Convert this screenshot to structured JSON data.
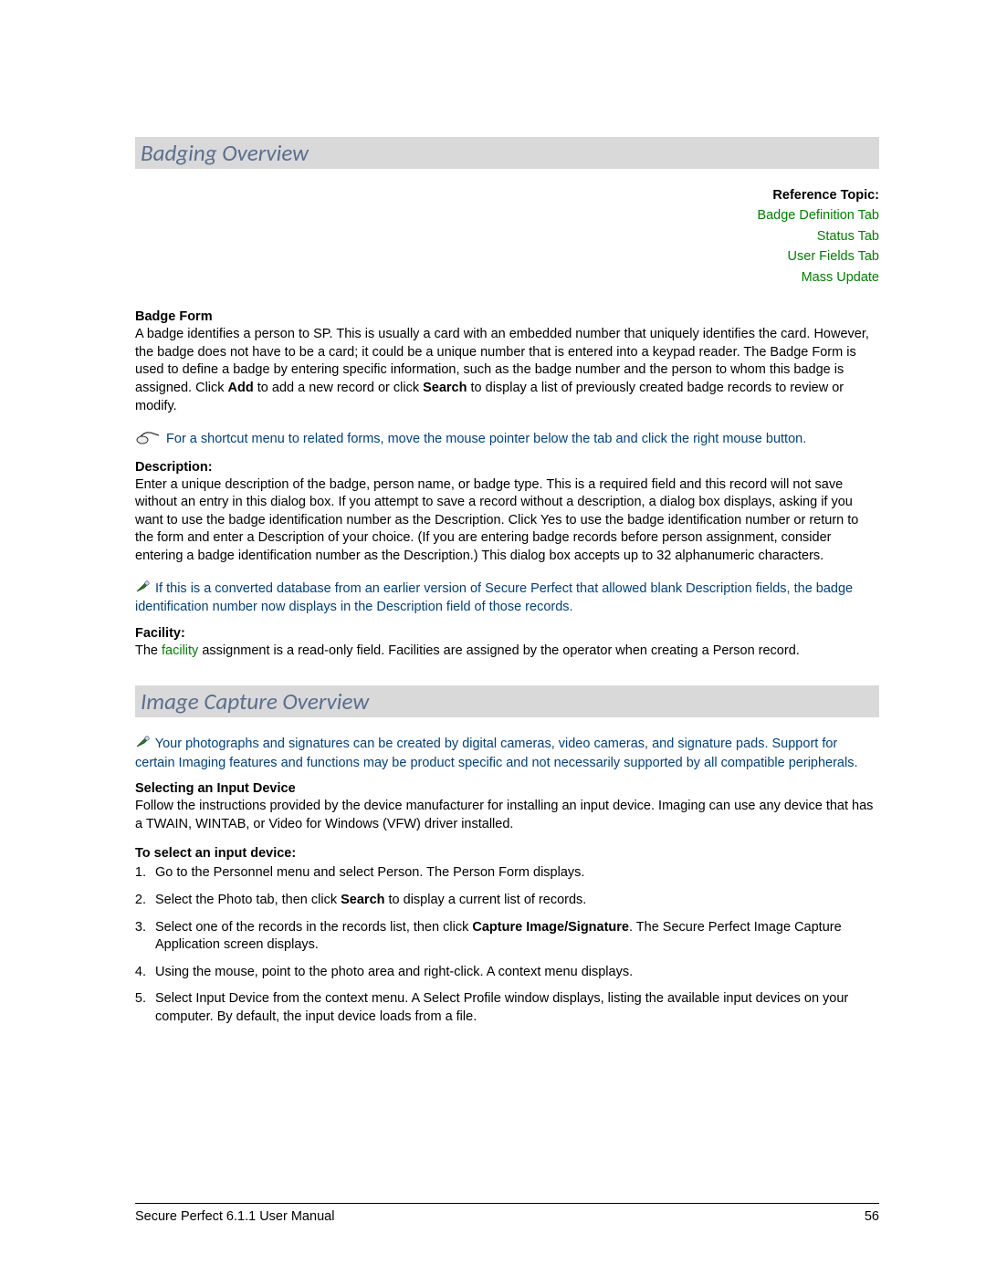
{
  "section1": {
    "title": "Badging Overview",
    "ref_label": "Reference Topic:",
    "refs": [
      "Badge Definition Tab",
      "Status Tab",
      "User Fields Tab",
      "Mass Update"
    ],
    "badge_form_head": "Badge Form",
    "badge_form_p1a": "A badge identifies a person to SP. This is usually a card with an embedded number that uniquely identifies the card. However, the badge does not have to be a card; it could be a unique number that is entered into a keypad reader. The Badge Form is used to define a badge by entering specific information, such as the badge number and the person to whom this badge is assigned. Click ",
    "badge_form_add": "Add",
    "badge_form_p1b": " to add a new record or click ",
    "badge_form_search": "Search",
    "badge_form_p1c": " to display a list of previously created badge records to review or modify.",
    "tip1": " For a shortcut menu to related forms, move the mouse pointer below the tab and click the right mouse button.",
    "desc_head": "Description:",
    "desc_body": "Enter a unique description of the badge, person name, or badge type. This is a required field and this record will not save without an entry in this dialog box. If you attempt to save a record without a description, a dialog box displays, asking if you want to use the badge identification number as the Description. Click Yes to use the badge identification number or return to the form and enter a Description of your choice. (If you are entering badge records before person assignment, consider entering a badge identification number as the Description.) This dialog box accepts up to 32 alphanumeric characters.",
    "note1": " If this is a converted database from an earlier version of Secure Perfect that allowed blank Description fields, the badge identification number now displays in the Description field of those records.",
    "fac_head": "Facility:",
    "fac_a": "The ",
    "fac_link": "facility",
    "fac_b": " assignment is a read-only field. Facilities are assigned by the operator when creating a Person record."
  },
  "section2": {
    "title": "Image Capture Overview",
    "note2": " Your photographs and signatures can be created by digital cameras, video cameras, and signature pads. Support for certain Imaging features and functions may be product specific and not necessarily supported by all compatible peripherals.",
    "sel_head": "Selecting an Input Device",
    "sel_body": "Follow the instructions provided by the device manufacturer for installing an input device. Imaging can use any device that has a TWAIN, WINTAB, or Video for Windows (VFW) driver installed.",
    "to_select_head": "To select an input device:",
    "steps": {
      "s1": "Go to the Personnel menu and select Person. The Person Form displays.",
      "s2a": "Select the Photo tab, then click ",
      "s2b": "Search",
      "s2c": " to display a current list of records.",
      "s3a": "Select one of the records in the records list, then click ",
      "s3b": "Capture Image/Signature",
      "s3c": ". The Secure Perfect Image Capture Application screen displays.",
      "s4": "Using the mouse, point to the photo area and right-click. A context menu displays.",
      "s5": "Select Input Device from the context menu. A Select Profile window displays, listing the available input devices on your computer. By default, the input device loads from a file."
    }
  },
  "footer": {
    "left": "Secure Perfect 6.1.1 User Manual",
    "right": "56"
  }
}
